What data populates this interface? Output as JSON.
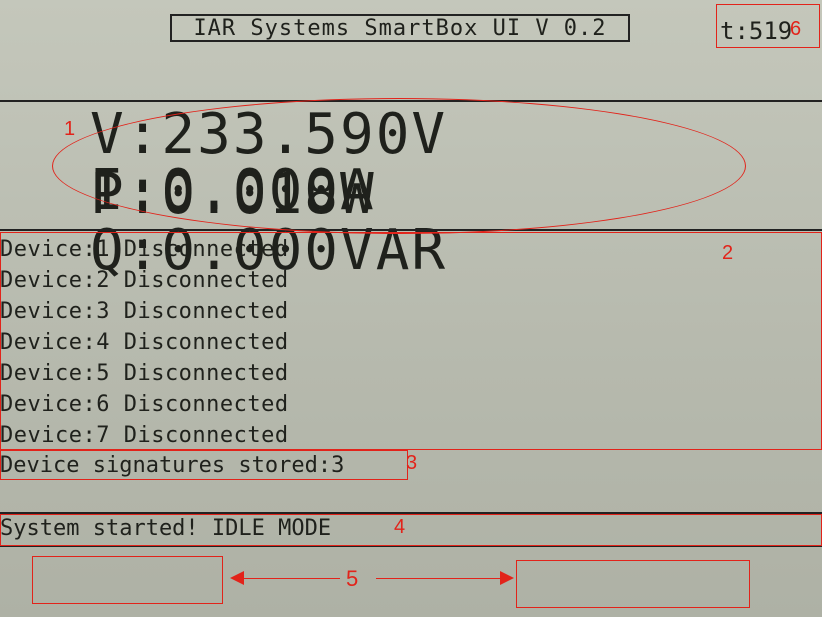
{
  "header": {
    "title": "IAR Systems SmartBox UI V 0.2",
    "timer": "t:519"
  },
  "measurements": {
    "voltage": "V:233.590V",
    "current": "I:0.000A",
    "power": "P:0.018W",
    "reactive_power": "Q:0.000VAR"
  },
  "devices": [
    "Device:1 Disconnected",
    "Device:2 Disconnected",
    "Device:3 Disconnected",
    "Device:4 Disconnected",
    "Device:5 Disconnected",
    "Device:6 Disconnected",
    "Device:7 Disconnected"
  ],
  "signatures": "Device signatures stored:3",
  "status": "System started! IDLE MODE",
  "annotations": {
    "labels": [
      "1",
      "2",
      "3",
      "4",
      "5",
      "6"
    ],
    "color": "#e2231a"
  }
}
